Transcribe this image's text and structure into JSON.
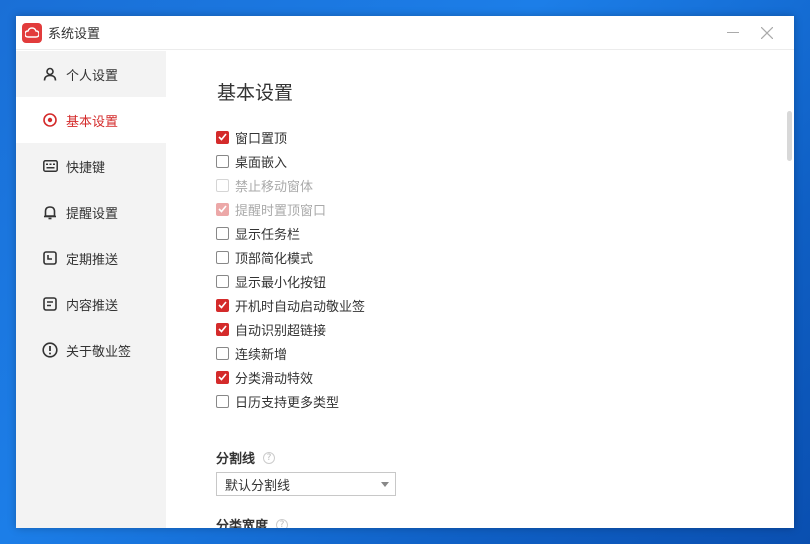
{
  "window": {
    "title": "系统设置"
  },
  "sidebar": {
    "items": [
      {
        "label": "个人设置",
        "icon": "user-icon",
        "active": false
      },
      {
        "label": "基本设置",
        "icon": "target-icon",
        "active": true
      },
      {
        "label": "快捷键",
        "icon": "keyboard-icon",
        "active": false
      },
      {
        "label": "提醒设置",
        "icon": "bell-icon",
        "active": false
      },
      {
        "label": "定期推送",
        "icon": "schedule-icon",
        "active": false
      },
      {
        "label": "内容推送",
        "icon": "document-icon",
        "active": false
      },
      {
        "label": "关于敬业签",
        "icon": "info-icon",
        "active": false
      }
    ]
  },
  "main": {
    "title": "基本设置",
    "options": [
      {
        "label": "窗口置顶",
        "checked": true,
        "disabled": false
      },
      {
        "label": "桌面嵌入",
        "checked": false,
        "disabled": false
      },
      {
        "label": "禁止移动窗体",
        "checked": false,
        "disabled": true
      },
      {
        "label": "提醒时置顶窗口",
        "checked": true,
        "disabled": true
      },
      {
        "label": "显示任务栏",
        "checked": false,
        "disabled": false
      },
      {
        "label": "顶部简化模式",
        "checked": false,
        "disabled": false
      },
      {
        "label": "显示最小化按钮",
        "checked": false,
        "disabled": false
      },
      {
        "label": "开机时自动启动敬业签",
        "checked": true,
        "disabled": false
      },
      {
        "label": "自动识别超链接",
        "checked": true,
        "disabled": false
      },
      {
        "label": "连续新增",
        "checked": false,
        "disabled": false
      },
      {
        "label": "分类滑动特效",
        "checked": true,
        "disabled": false
      },
      {
        "label": "日历支持更多类型",
        "checked": false,
        "disabled": false
      }
    ],
    "divider_field": {
      "label": "分割线",
      "help": "?",
      "value": "默认分割线"
    },
    "width_field": {
      "label": "分类宽度",
      "help": "?",
      "value": ""
    }
  },
  "colors": {
    "accent": "#d42b2b",
    "logo": "#e23c3c"
  }
}
